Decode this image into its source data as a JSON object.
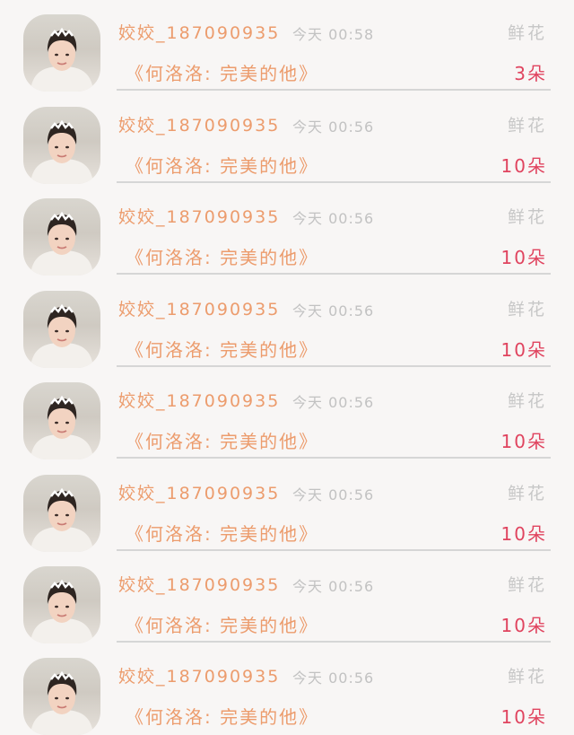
{
  "gift_list": {
    "items": [
      {
        "user_name": "姣姣_187090935",
        "time": "今天 00:58",
        "gift_name": "鲜花",
        "song_title": "《何洛洛: 完美的他》",
        "gift_count": "3朵"
      },
      {
        "user_name": "姣姣_187090935",
        "time": "今天 00:56",
        "gift_name": "鲜花",
        "song_title": "《何洛洛: 完美的他》",
        "gift_count": "10朵"
      },
      {
        "user_name": "姣姣_187090935",
        "time": "今天 00:56",
        "gift_name": "鲜花",
        "song_title": "《何洛洛: 完美的他》",
        "gift_count": "10朵"
      },
      {
        "user_name": "姣姣_187090935",
        "time": "今天 00:56",
        "gift_name": "鲜花",
        "song_title": "《何洛洛: 完美的他》",
        "gift_count": "10朵"
      },
      {
        "user_name": "姣姣_187090935",
        "time": "今天 00:56",
        "gift_name": "鲜花",
        "song_title": "《何洛洛: 完美的他》",
        "gift_count": "10朵"
      },
      {
        "user_name": "姣姣_187090935",
        "time": "今天 00:56",
        "gift_name": "鲜花",
        "song_title": "《何洛洛: 完美的他》",
        "gift_count": "10朵"
      },
      {
        "user_name": "姣姣_187090935",
        "time": "今天 00:56",
        "gift_name": "鲜花",
        "song_title": "《何洛洛: 完美的他》",
        "gift_count": "10朵"
      },
      {
        "user_name": "姣姣_187090935",
        "time": "今天 00:56",
        "gift_name": "鲜花",
        "song_title": "《何洛洛: 完美的他》",
        "gift_count": "10朵"
      }
    ]
  },
  "colors": {
    "background": "#f8f6f5",
    "name_text": "#ec9c6d",
    "time_text": "#c2c2c2",
    "gift_label": "#c7c7c7",
    "count_text": "#e0445f",
    "divider": "#d6d6d6"
  },
  "icons": {
    "avatar": "user-avatar-photo"
  }
}
